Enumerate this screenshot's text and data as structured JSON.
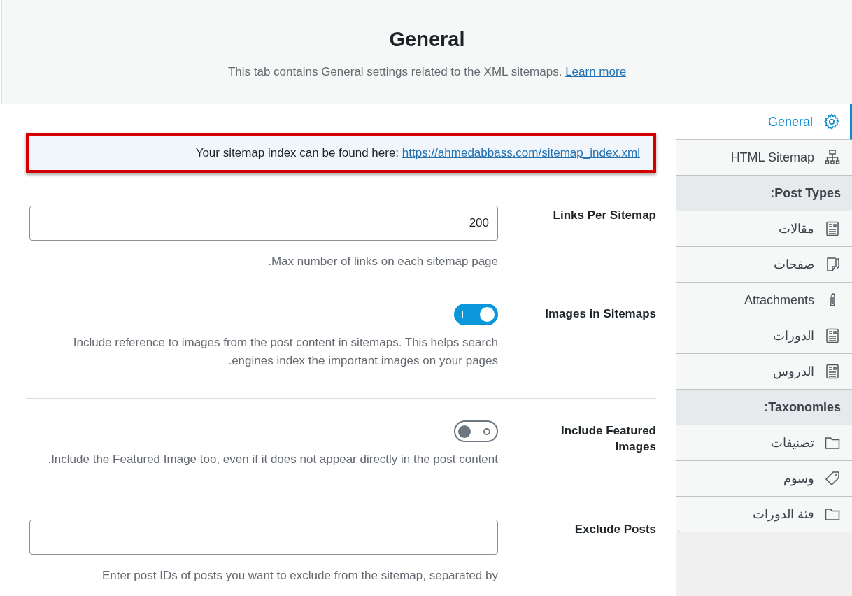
{
  "header": {
    "title": "General",
    "description": "This tab contains General settings related to the XML sitemaps.",
    "link": "Learn more"
  },
  "notice": {
    "text": "Your sitemap index can be found here:",
    "link": "https://ahmedabbass.com/sitemap_index.xml"
  },
  "settings": [
    {
      "kind": "input",
      "label": "Links Per Sitemap",
      "value": "200",
      "description": "Max number of links on each sitemap page."
    },
    {
      "kind": "toggle",
      "label": "Images in Sitemaps",
      "on": true,
      "description": "Include reference to images from the post content in sitemaps. This helps search engines index the important images on your pages."
    },
    {
      "kind": "toggle",
      "label": "Include Featured Images",
      "on": false,
      "description": "Include the Featured Image too, even if it does not appear directly in the post content."
    },
    {
      "kind": "input",
      "label": "Exclude Posts",
      "description": "Enter post IDs of posts you want to exclude from the sitemap, separated by"
    }
  ],
  "sidebar": {
    "items": [
      {
        "kind": "item",
        "label": "General",
        "selected": true
      },
      {
        "kind": "item",
        "label": "HTML Sitemap",
        "selected": false
      },
      {
        "kind": "heading",
        "label": "Post Types:"
      },
      {
        "kind": "item",
        "label": "مقالات",
        "selected": false
      },
      {
        "kind": "item",
        "label": "صفحات",
        "selected": false
      },
      {
        "kind": "item",
        "label": "Attachments",
        "selected": false
      },
      {
        "kind": "item",
        "label": "الدورات",
        "selected": false
      },
      {
        "kind": "item",
        "label": "الدروس",
        "selected": false
      },
      {
        "kind": "heading",
        "label": "Taxonomies:"
      },
      {
        "kind": "item",
        "label": "تصنيفات",
        "selected": false
      },
      {
        "kind": "item",
        "label": "وسوم",
        "selected": false
      },
      {
        "kind": "item",
        "label": "فئة الدورات",
        "selected": false
      }
    ]
  }
}
